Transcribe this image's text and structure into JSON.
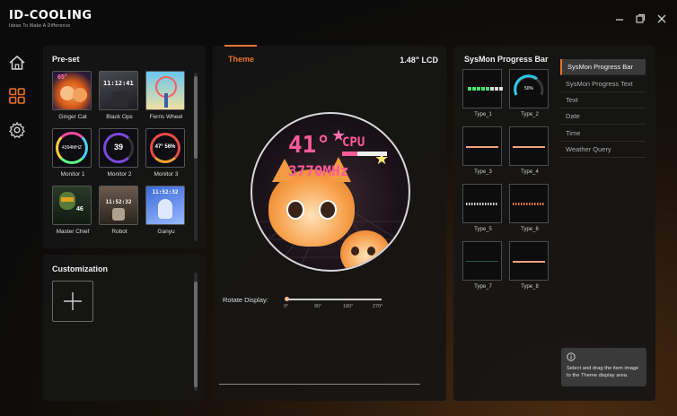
{
  "app": {
    "logo_text": "ID-COOLING",
    "logo_tagline": "Ideas To Make A Difference"
  },
  "window_controls": {
    "minimize_icon": "minimize-icon",
    "restore_icon": "restore-icon",
    "close_icon": "close-icon"
  },
  "rail": {
    "items": [
      {
        "icon": "home-icon"
      },
      {
        "icon": "grid-icon",
        "active": true
      },
      {
        "icon": "gear-icon"
      }
    ]
  },
  "preset": {
    "title": "Pre-set",
    "items": [
      {
        "label": "Ginger Cat",
        "thumb_text": "65°"
      },
      {
        "label": "Black Ops",
        "thumb_text": "11:12:41"
      },
      {
        "label": "Ferris Wheel",
        "thumb_text": ""
      },
      {
        "label": "Monitor 1",
        "thumb_text": "4394MHZ"
      },
      {
        "label": "Monitor 2",
        "thumb_text": "39"
      },
      {
        "label": "Monitor 3",
        "thumb_text": "47° 56%"
      },
      {
        "label": "Master Chief",
        "thumb_text": "46"
      },
      {
        "label": "Robot",
        "thumb_text": "11:52:32"
      },
      {
        "label": "Ganyu",
        "thumb_text": "11:52:32"
      }
    ]
  },
  "customization": {
    "title": "Customization",
    "add_icon": "plus-icon"
  },
  "theme": {
    "tab_label": "Theme",
    "lcd_label": "1.48\" LCD",
    "preview": {
      "temp": "41°",
      "cpu_label": "CPU",
      "freq": "3770MHz"
    },
    "rotate_label": "Rotate Display:",
    "rotate_ticks": [
      "0°",
      "90°",
      "180°",
      "270°"
    ],
    "rotate_value": "0°"
  },
  "sysmon": {
    "title": "SysMon Progress Bar",
    "types": [
      {
        "label": "Type_1"
      },
      {
        "label": "Type_2",
        "value_text": "50%"
      },
      {
        "label": "Type_3"
      },
      {
        "label": "Type_4"
      },
      {
        "label": "Type_5"
      },
      {
        "label": "Type_6"
      },
      {
        "label": "Type_7"
      },
      {
        "label": "Type_8"
      }
    ]
  },
  "side_menu": {
    "items": [
      {
        "label": "SysMon Progress Bar",
        "active": true
      },
      {
        "label": "SysMon Progress Text"
      },
      {
        "label": "Text"
      },
      {
        "label": "Date"
      },
      {
        "label": "Time"
      },
      {
        "label": "Weather Query"
      }
    ]
  },
  "hint": {
    "icon": "info-icon",
    "text": "Select and drag the item image to the Theme display area."
  },
  "colors": {
    "accent": "#e8732a",
    "pink": "#ff5a9a",
    "cyan": "#2ec8e8"
  }
}
